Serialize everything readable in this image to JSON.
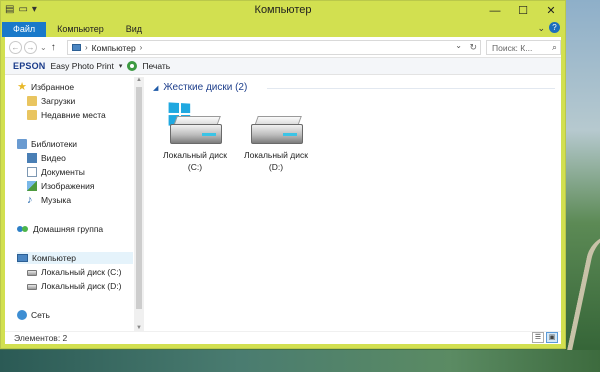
{
  "window": {
    "title": "Компьютер",
    "qat_icons": [
      "properties-icon",
      "new-folder-icon",
      "qat-dropdown-icon"
    ],
    "controls": {
      "minimize": "—",
      "maximize": "☐",
      "close": "✕"
    }
  },
  "ribbon": {
    "tabs": [
      "Файл",
      "Компьютер",
      "Вид"
    ],
    "active_tab": "Файл",
    "toggle_glyph": "⌄",
    "help_glyph": "?"
  },
  "address_bar": {
    "back": "←",
    "forward": "→",
    "recent": "⌄",
    "up": "↑",
    "crumbs": [
      "Компьютер"
    ],
    "crumb_separator": "›",
    "history_glyph": "⌄",
    "refresh": "↻",
    "search_placeholder": "Поиск: К...",
    "search_glyph": "⌕"
  },
  "toolbar": {
    "brand": "EPSON",
    "easy_photo_print": "Easy Photo Print",
    "dropdown": "▾",
    "print": "Печать"
  },
  "navigation": {
    "favorites": {
      "label": "Избранное",
      "items": [
        "Загрузки",
        "Недавние места"
      ]
    },
    "libraries": {
      "label": "Библиотеки",
      "items": [
        "Видео",
        "Документы",
        "Изображения",
        "Музыка"
      ]
    },
    "homegroup": "Домашняя группа",
    "computer": {
      "label": "Компьютер",
      "items": [
        "Локальный диск (C:)",
        "Локальный диск (D:)"
      ]
    },
    "network": "Сеть"
  },
  "content": {
    "section_title": "Жесткие диски (2)",
    "drives": [
      {
        "name": "Локальный диск",
        "letter": "(C:)",
        "system": true
      },
      {
        "name": "Локальный диск",
        "letter": "(D:)",
        "system": false
      }
    ]
  },
  "status": {
    "items_count": "Элементов: 2",
    "views": [
      "details-view",
      "large-icons-view"
    ],
    "active_view": "large-icons-view"
  },
  "colors": {
    "window_frame": "#d2e050",
    "file_tab": "#1979ca",
    "section_title": "#1e3f8c",
    "windows_logo": "#1fa8e0"
  }
}
